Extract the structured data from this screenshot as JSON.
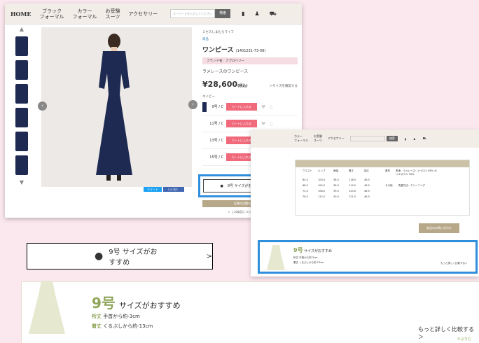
{
  "nav": {
    "home": "HOME",
    "items": [
      "ブラック\nフォーマル",
      "カラー\nフォーマル",
      "お受験\nスーツ",
      "アクセサリー"
    ],
    "search_placeholder": "キーワードを入力してください",
    "search_button": "検索"
  },
  "product": {
    "maker": "ミセスしまむらライフ",
    "category": "商品",
    "title": "ワンピース",
    "code": "(1401231-73-08)",
    "brand": "ブランド名：アプロベリー",
    "subtitle": "ラメレースのワンピース",
    "price": "¥28,600",
    "tax": "(税込)",
    "size_chart_link": "＞サイズを確認する",
    "color_label": "ネイビー",
    "sizes": [
      "9号 / C",
      "11号 / C",
      "13号 / C",
      "15号 / C"
    ],
    "cart_label": "カートに入れる",
    "tweet": "ツイート",
    "like": "いいね！",
    "recommend": "9号 サイズがおすすめ",
    "recommend_sub": "＞",
    "store_button": "近隣の店舗を確認する",
    "store_note": "＞ この商品についてお問い合わせ"
  },
  "second": {
    "nav_items": [
      "カラー\nフォーマル",
      "お受験\nスーツ",
      "アクセサリー"
    ],
    "search_button": "検索",
    "headers": [
      "ウエスト",
      "ヒップ",
      "肩幅",
      "着丈",
      "袖丈"
    ],
    "rows": [
      [
        "64.0",
        "100.0",
        "38.0",
        "118.0",
        "46.5"
      ],
      [
        "68.0",
        "104.0",
        "38.0",
        "119.0",
        "46.5"
      ],
      [
        "72.0",
        "108.0",
        "39.0",
        "120.0",
        "46.5"
      ],
      [
        "76.0",
        "112.0",
        "40.0",
        "121.0",
        "46.5"
      ]
    ],
    "label_material": "素材",
    "label_other": "その他",
    "material_text": "表地：ラメレース：ナイロン 65% ポリエステル 35%",
    "other_text": "洗濯方法：クリーニング",
    "more_button": "商品のお問い合わせ",
    "recommend_size": "9号",
    "recommend_text": "サイズがおすすめ",
    "line1": "裄丈 手首から約-3cm",
    "line2": "着丈 くるぶしから約-13cm",
    "detail": "もっと詳しく比較する＞"
  },
  "callout": {
    "label": "9号 サイズがおすすめ",
    "chev": ">"
  },
  "bottom": {
    "size": "9号",
    "text": "サイズがおすすめ",
    "l1_tag": "裄丈",
    "l1": "手首から約-3cm",
    "l2_tag": "着丈",
    "l2": "くるぶしから約-13cm",
    "detail": "もっと詳しく比較する＞",
    "credit": "©ぷりむ"
  },
  "colors": {
    "accent": "#f06a7c",
    "highlight": "#2f8fdc",
    "navy": "#1e2a52",
    "green": "#8fa55a"
  }
}
